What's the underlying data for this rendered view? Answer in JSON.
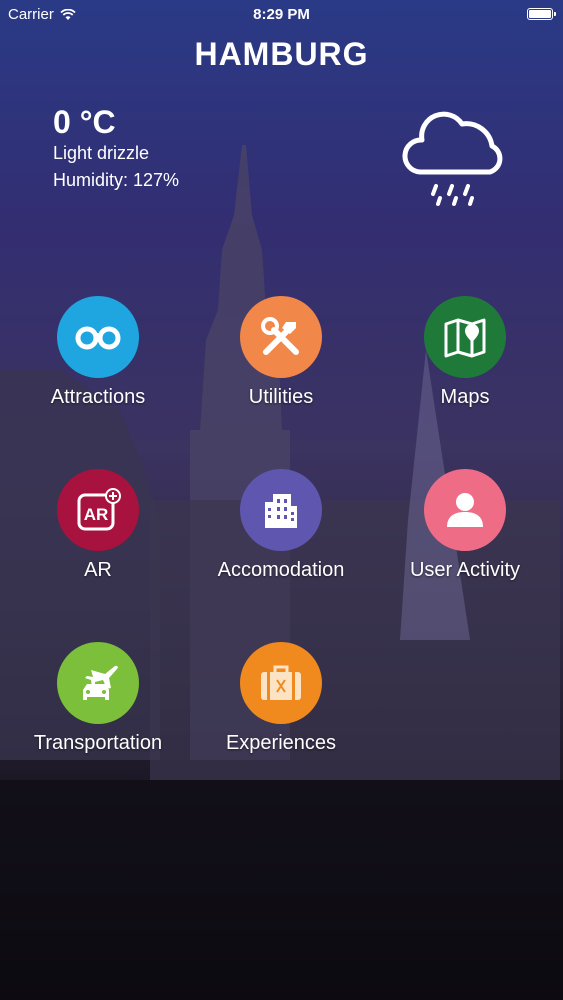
{
  "status_bar": {
    "carrier": "Carrier",
    "time": "8:29 PM"
  },
  "city": "HAMBURG",
  "weather": {
    "temperature": "0 °C",
    "condition": "Light drizzle",
    "humidity_label": "Humidity:",
    "humidity_value": "127%",
    "icon": "cloud-rain-icon"
  },
  "menu": {
    "items": [
      {
        "label": "Attractions",
        "icon": "binoculars-icon",
        "color": "#1fa6e0"
      },
      {
        "label": "Utilities",
        "icon": "tools-icon",
        "color": "#f2874a"
      },
      {
        "label": "Maps",
        "icon": "map-icon",
        "color": "#1f7a3a"
      },
      {
        "label": "AR",
        "icon": "ar-icon",
        "color": "#a8123e"
      },
      {
        "label": "Accomodation",
        "icon": "building-icon",
        "color": "#5f56b0"
      },
      {
        "label": "User Activity",
        "icon": "user-icon",
        "color": "#ef6c86"
      },
      {
        "label": "Transportation",
        "icon": "plane-car-icon",
        "color": "#7cbf3a"
      },
      {
        "label": "Experiences",
        "icon": "suitcase-icon",
        "color": "#f08a1e"
      }
    ]
  }
}
